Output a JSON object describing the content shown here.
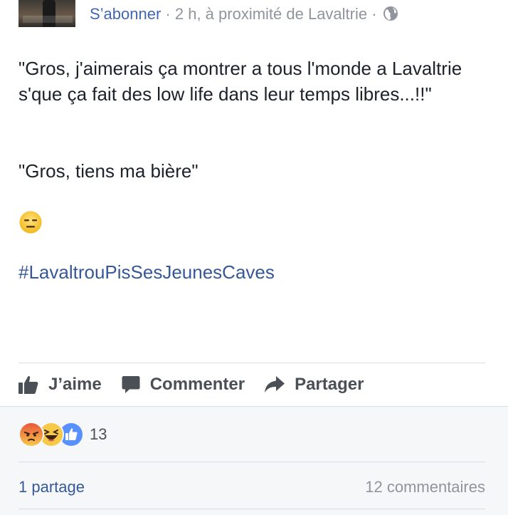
{
  "post": {
    "follow_label": "S’abonner",
    "meta": " · 2 h, à proximité de Lavaltrie · ",
    "paragraph1": "\"Gros, j'aimerais ça montrer a tous l'monde a Lavaltrie s'que ça fait des low life dans leur temps libres...!!\"",
    "paragraph2": "\"Gros, tiens ma bière\"",
    "emoji": "expressionless-face-emoji",
    "hashtag": "#LavaltrouPisSesJeunesCaves"
  },
  "actions": {
    "like_label": "J’aime",
    "comment_label": "Commenter",
    "share_label": "Partager"
  },
  "footer": {
    "reactions": [
      "angry",
      "haha",
      "like"
    ],
    "reaction_count": "13",
    "shares_label": "1 partage",
    "comments_label": "12 commentaires"
  },
  "colors": {
    "link": "#365899",
    "follow": "#4267b2",
    "meta": "#90949c",
    "action_text": "#4b4f56"
  }
}
